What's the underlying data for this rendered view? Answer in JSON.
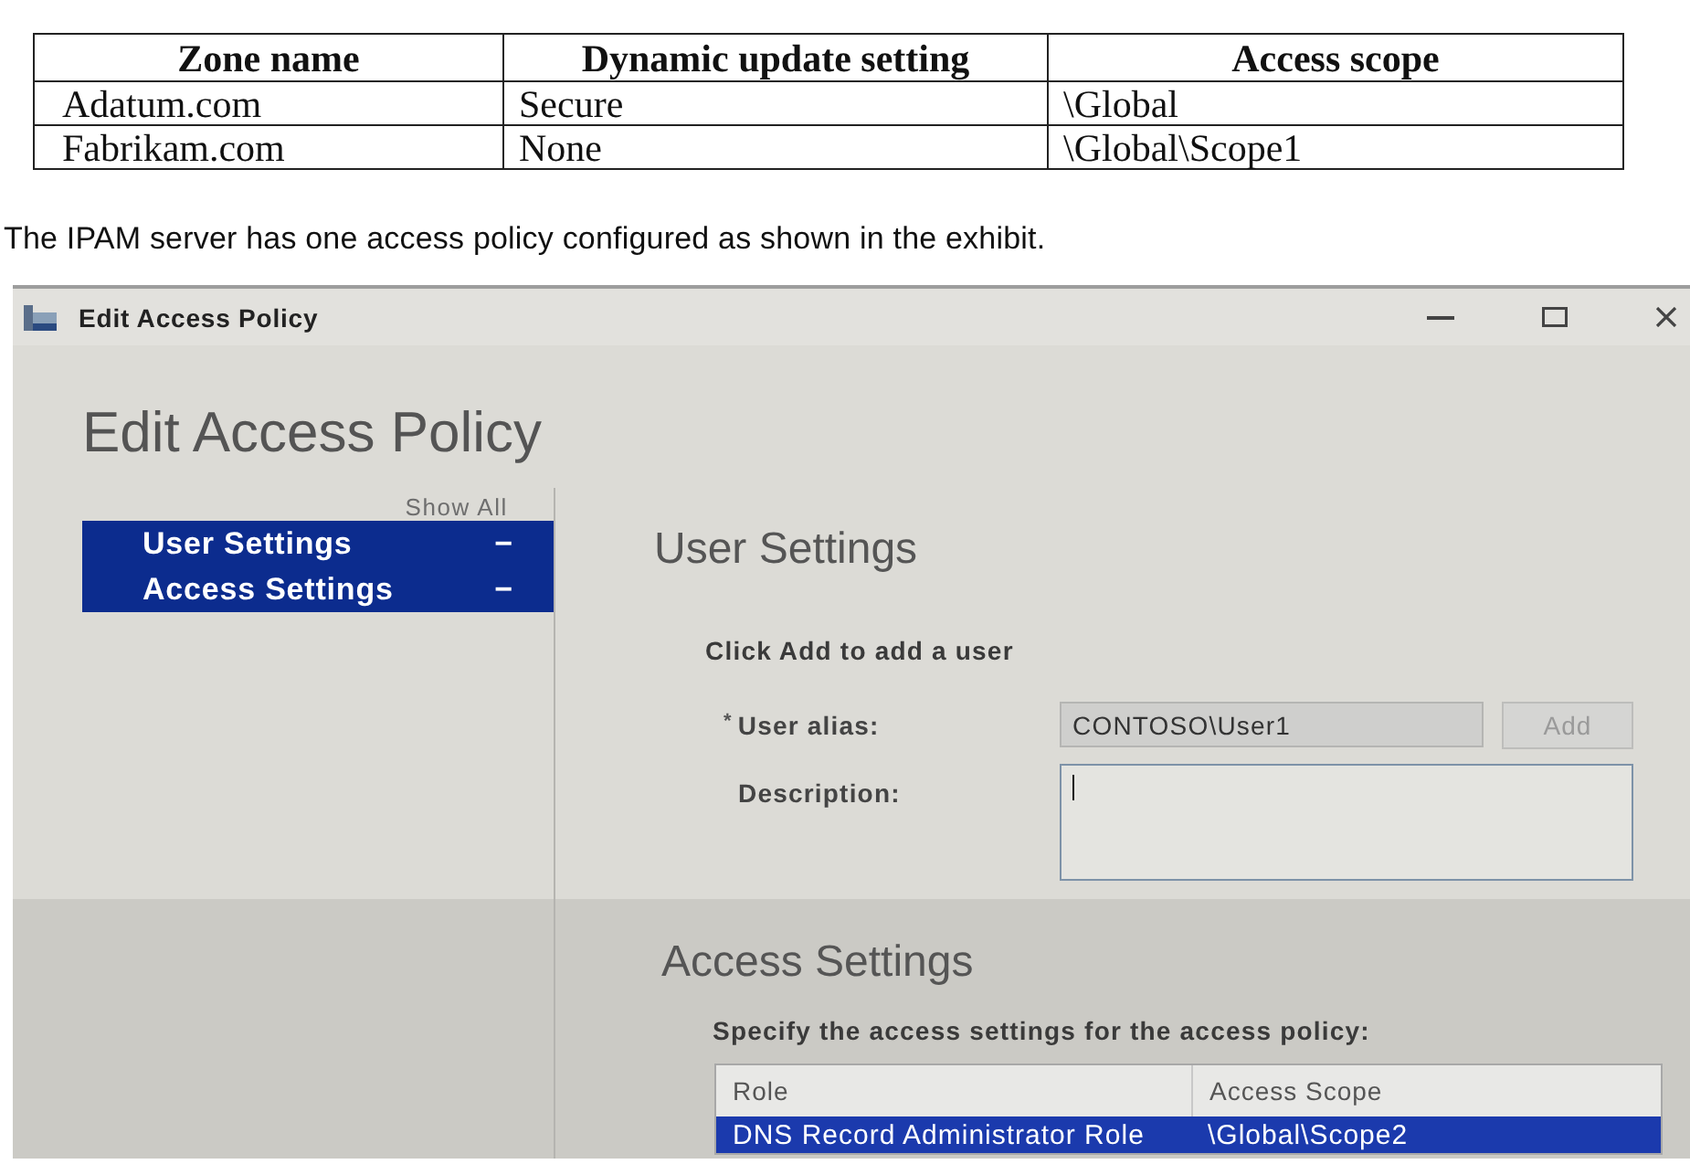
{
  "zone_table": {
    "columns": [
      "Zone name",
      "Dynamic update setting",
      "Access scope"
    ],
    "rows": [
      [
        "Adatum.com",
        "Secure",
        "\\Global"
      ],
      [
        "Fabrikam.com",
        "None",
        "\\Global\\Scope1"
      ]
    ]
  },
  "intro_text": "The IPAM server has one access policy configured as shown in the exhibit.",
  "window": {
    "title": "Edit Access Policy",
    "heading": "Edit Access Policy",
    "nav": {
      "show_all": "Show All",
      "items": [
        {
          "label": "User Settings",
          "toggle": "−",
          "selected": true
        },
        {
          "label": "Access Settings",
          "toggle": "−",
          "selected": true
        }
      ]
    },
    "user_settings": {
      "heading": "User Settings",
      "instruction": "Click Add to add a user",
      "fields": [
        {
          "kind": "line",
          "required_mark": "*",
          "label": "User alias:",
          "value": "CONTOSO\\User1",
          "read_only": true,
          "focused": false,
          "button": {
            "label": "Add",
            "disabled": true
          }
        },
        {
          "kind": "area",
          "label": "Description:",
          "read_only": false,
          "focused": true
        }
      ]
    },
    "access_settings": {
      "heading": "Access Settings",
      "instruction": "Specify the access settings for the access policy:",
      "table": {
        "columns": [
          "Role",
          "Access Scope"
        ],
        "rows": [
          {
            "cells": [
              "DNS Record Administrator Role",
              "\\Global\\Scope2"
            ],
            "selected": true
          }
        ]
      }
    }
  }
}
